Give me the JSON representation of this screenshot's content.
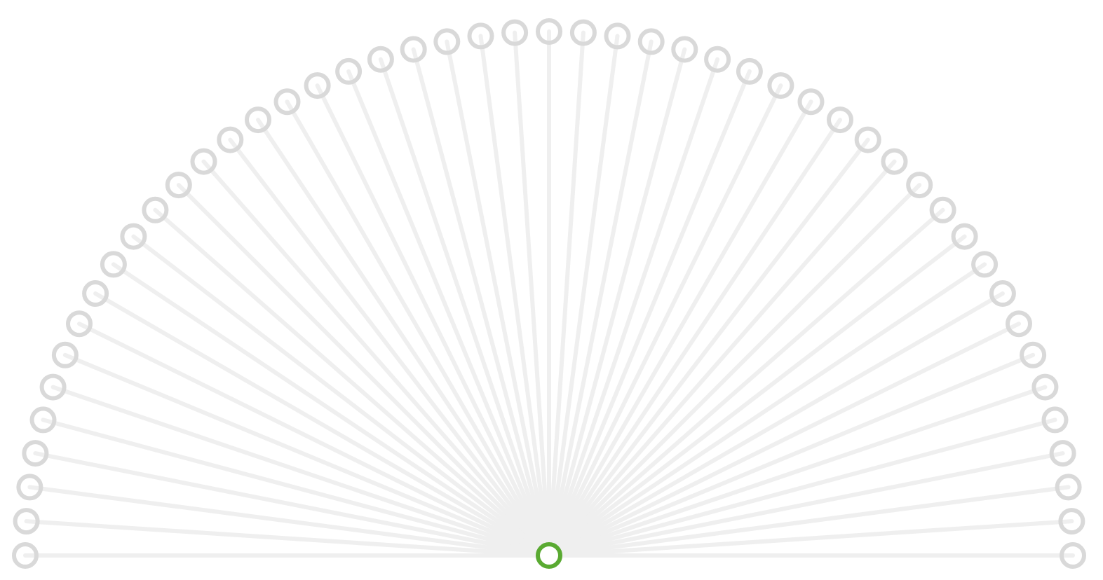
{
  "diagram": {
    "type": "radial-fan",
    "leaf_count": 49,
    "hub_color": "#5aaa32",
    "leaf_color": "#d9d9d9",
    "edge_color": "#efefef"
  }
}
